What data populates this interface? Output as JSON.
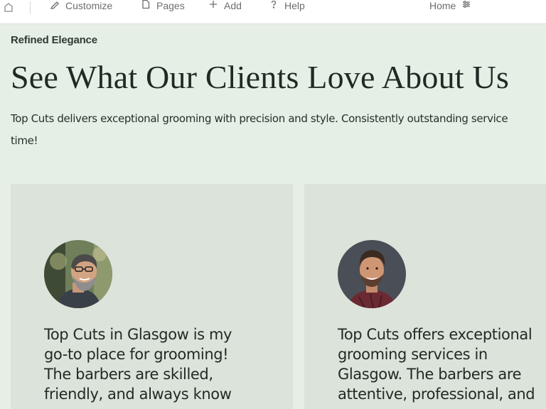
{
  "toolbar": {
    "customize_label": "Customize",
    "pages_label": "Pages",
    "add_label": "Add",
    "help_label": "Help",
    "current_page_label": "Home"
  },
  "section": {
    "eyebrow": "Refined Elegance",
    "headline": "See What Our Clients Love About Us",
    "intro": "Top Cuts delivers exceptional grooming with precision and style. Consistently outstanding service\ntime!"
  },
  "testimonials": [
    {
      "quote": "Top Cuts in Glasgow is my go-to place for grooming! The barbers are skilled, friendly, and always know"
    },
    {
      "quote": "Top Cuts offers exceptional grooming services in Glasgow. The barbers are attentive, professional, and"
    }
  ],
  "colors": {
    "page_background": "#e6efe6",
    "card_background": "#dbe3da",
    "text": "#1f2a24",
    "toolbar_text": "#6d6d6d"
  },
  "icons": {
    "home": "home-icon",
    "customize": "brush-icon",
    "pages": "page-icon",
    "add": "plus-icon",
    "help": "question-icon",
    "page_select": "sliders-icon"
  }
}
